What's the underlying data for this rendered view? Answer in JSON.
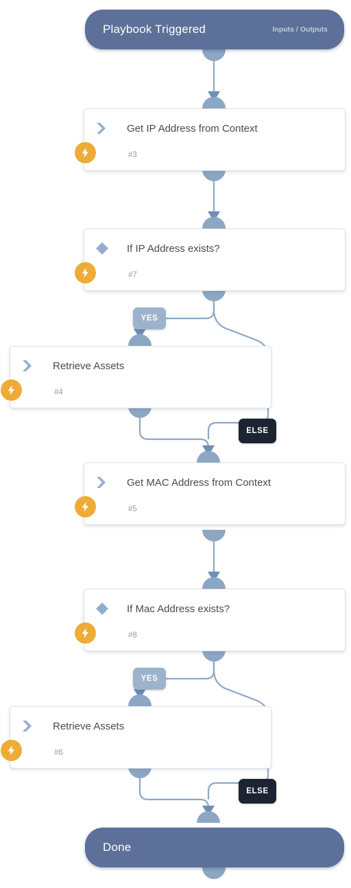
{
  "diagram": {
    "type": "playbook-flow",
    "background_color": "#ffffff",
    "accent_color": "#5c7099",
    "connector_color": "#8ca7c4",
    "badge_color": "#eeab36"
  },
  "start_node": {
    "title": "Playbook Triggered",
    "aux_label": "Inputs / Outputs",
    "icon": "none"
  },
  "end_node": {
    "title": "Done",
    "icon": "none"
  },
  "nodes": [
    {
      "id": "n3",
      "title": "Get IP Address from Context",
      "number": "#3",
      "icon": "double-chevron-right-icon",
      "kind": "task"
    },
    {
      "id": "n7",
      "title": "If IP Address exists?",
      "number": "#7",
      "icon": "diamond-icon",
      "kind": "condition"
    },
    {
      "id": "n4",
      "title": "Retrieve Assets",
      "number": "#4",
      "icon": "double-chevron-right-icon",
      "kind": "task"
    },
    {
      "id": "n5",
      "title": "Get MAC Address from Context",
      "number": "#5",
      "icon": "double-chevron-right-icon",
      "kind": "task"
    },
    {
      "id": "n8",
      "title": "If Mac Address exists?",
      "number": "#8",
      "icon": "diamond-icon",
      "kind": "condition"
    },
    {
      "id": "n6",
      "title": "Retrieve Assets",
      "number": "#6",
      "icon": "double-chevron-right-icon",
      "kind": "task"
    }
  ],
  "branch_labels": {
    "yes_1": "YES",
    "else_1": "ELSE",
    "yes_2": "YES",
    "else_2": "ELSE"
  }
}
